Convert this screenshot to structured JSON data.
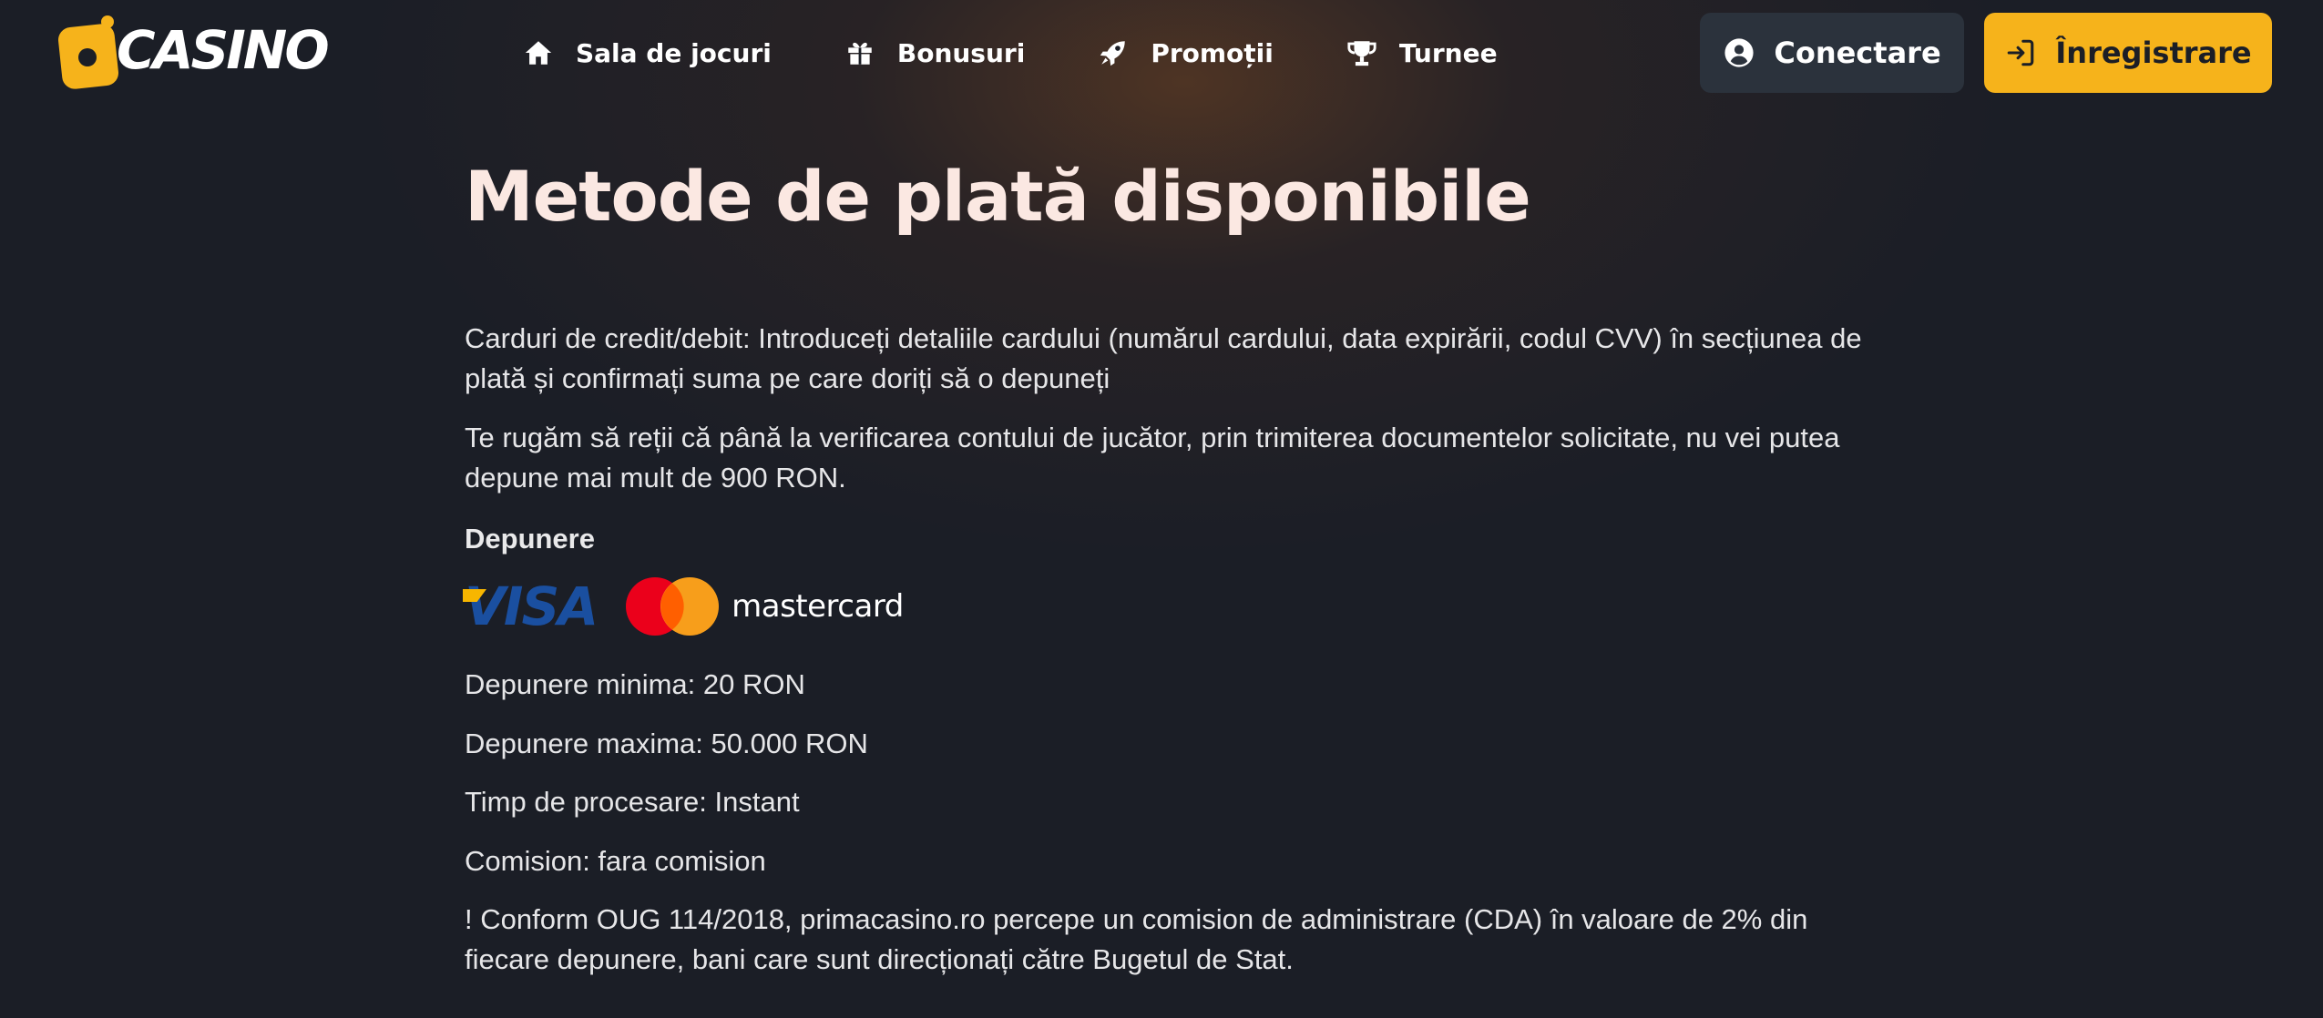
{
  "brand": {
    "logo_text": "CASINO",
    "accent_color": "#f6b31b"
  },
  "nav": {
    "items": [
      {
        "label": "Sala de jocuri",
        "icon": "home-icon"
      },
      {
        "label": "Bonusuri",
        "icon": "gift-icon"
      },
      {
        "label": "Promoții",
        "icon": "rocket-icon"
      },
      {
        "label": "Turnee",
        "icon": "trophy-icon"
      }
    ]
  },
  "auth": {
    "login_label": "Conectare",
    "login_icon": "user-circle-icon",
    "register_label": "Înregistrare",
    "register_icon": "sign-in-icon"
  },
  "main": {
    "title": "Metode de plată disponibile",
    "paragraphs": [
      "Carduri de credit/debit: Introduceți detaliile cardului (numărul cardului, data expirării, codul CVV) în secțiunea de plată și confirmați suma pe care doriți să o depuneți",
      "Te rugăm să reții că până la verificarea contului de jucător, prin trimiterea documentelor solicitate, nu vei putea depune mai mult de 900 RON."
    ],
    "deposit": {
      "heading": "Depunere",
      "payment_logos": {
        "visa": "VISA",
        "mastercard": "mastercard"
      },
      "min": "Depunere minima: 20 RON",
      "max": "Depunere maxima: 50.000 RON",
      "processing": "Timp de procesare: Instant",
      "fee": "Comision: fara comision",
      "note": "! Conform OUG 114/2018, primacasino.ro percepe un comision de administrare (CDA) în valoare de 2% din fiecare depunere, bani care sunt direcționați către Bugetul de Stat."
    }
  }
}
